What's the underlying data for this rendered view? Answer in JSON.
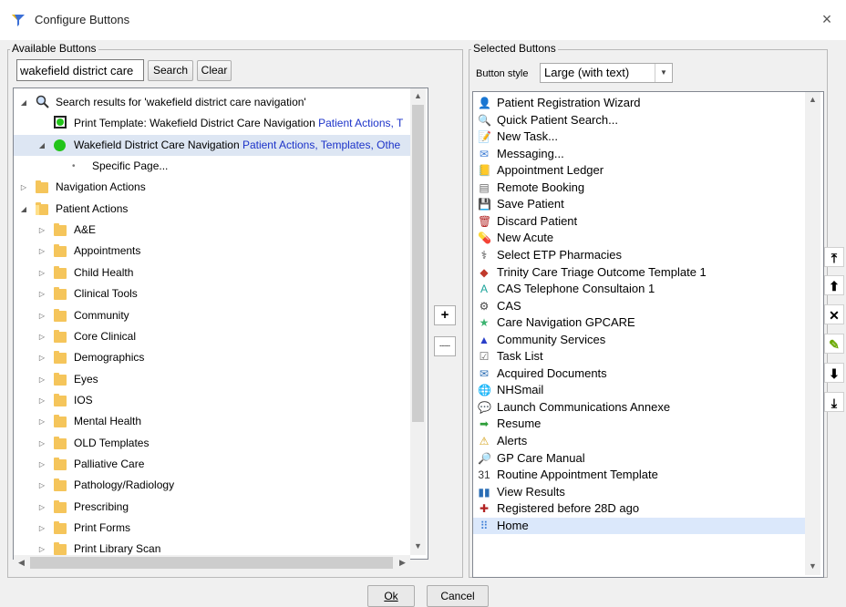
{
  "window": {
    "title": "Configure Buttons",
    "close_glyph": "×",
    "title_icon": "funnel-icon"
  },
  "available": {
    "legend": "Available Buttons",
    "search_value": "wakefield district care",
    "search_button": "Search",
    "clear_button": "Clear",
    "tree": [
      {
        "indent": 0,
        "expander": "◢",
        "icon": "search-icon",
        "text": "Search results for 'wakefield district care navigation'",
        "extra": ""
      },
      {
        "indent": 1,
        "expander": "",
        "icon": "green-dot-boxed-icon",
        "text": "Print Template: Wakefield District Care Navigation ",
        "extra": "Patient Actions, T"
      },
      {
        "indent": 1,
        "expander": "◢",
        "icon": "green-dot-icon",
        "text": "Wakefield District Care Navigation ",
        "extra": "Patient Actions, Templates, Othe",
        "selected": true
      },
      {
        "indent": 2,
        "expander": "",
        "icon": "bullet-icon",
        "text": "Specific Page...",
        "extra": ""
      },
      {
        "indent": 0,
        "expander": "▷",
        "icon": "folder-icon",
        "text": "Navigation Actions",
        "extra": ""
      },
      {
        "indent": 0,
        "expander": "◢",
        "icon": "folder-open-icon",
        "text": "Patient Actions",
        "extra": ""
      },
      {
        "indent": 1,
        "expander": "▷",
        "icon": "folder-icon",
        "text": "A&E",
        "extra": ""
      },
      {
        "indent": 1,
        "expander": "▷",
        "icon": "folder-icon",
        "text": "Appointments",
        "extra": ""
      },
      {
        "indent": 1,
        "expander": "▷",
        "icon": "folder-icon",
        "text": "Child Health",
        "extra": ""
      },
      {
        "indent": 1,
        "expander": "▷",
        "icon": "folder-icon",
        "text": "Clinical Tools",
        "extra": ""
      },
      {
        "indent": 1,
        "expander": "▷",
        "icon": "folder-icon",
        "text": "Community",
        "extra": ""
      },
      {
        "indent": 1,
        "expander": "▷",
        "icon": "folder-icon",
        "text": "Core Clinical",
        "extra": ""
      },
      {
        "indent": 1,
        "expander": "▷",
        "icon": "folder-icon",
        "text": "Demographics",
        "extra": ""
      },
      {
        "indent": 1,
        "expander": "▷",
        "icon": "folder-icon",
        "text": "Eyes",
        "extra": ""
      },
      {
        "indent": 1,
        "expander": "▷",
        "icon": "folder-icon",
        "text": "IOS",
        "extra": ""
      },
      {
        "indent": 1,
        "expander": "▷",
        "icon": "folder-icon",
        "text": "Mental Health",
        "extra": ""
      },
      {
        "indent": 1,
        "expander": "▷",
        "icon": "folder-icon",
        "text": "OLD Templates",
        "extra": ""
      },
      {
        "indent": 1,
        "expander": "▷",
        "icon": "folder-icon",
        "text": "Palliative Care",
        "extra": ""
      },
      {
        "indent": 1,
        "expander": "▷",
        "icon": "folder-icon",
        "text": "Pathology/Radiology",
        "extra": ""
      },
      {
        "indent": 1,
        "expander": "▷",
        "icon": "folder-icon",
        "text": "Prescribing",
        "extra": ""
      },
      {
        "indent": 1,
        "expander": "▷",
        "icon": "folder-icon",
        "text": "Print Forms",
        "extra": ""
      },
      {
        "indent": 1,
        "expander": "▷",
        "icon": "folder-icon",
        "text": "Print Library Scan",
        "extra": ""
      }
    ]
  },
  "middle": {
    "add_glyph": "+",
    "separator_glyph": "......"
  },
  "selected": {
    "legend": "Selected Buttons",
    "style_label": "Button style",
    "style_value": "Large (with text)",
    "items": [
      {
        "icon": "👤",
        "icon_name": "patient-registration-icon",
        "color": "#2a6db5",
        "text": "Patient Registration Wizard"
      },
      {
        "icon": "🔍",
        "icon_name": "quick-search-icon",
        "color": "#555",
        "text": "Quick Patient Search..."
      },
      {
        "icon": "📝",
        "icon_name": "new-task-icon",
        "color": "#8a6d3b",
        "text": "New Task..."
      },
      {
        "icon": "✉",
        "icon_name": "messaging-icon",
        "color": "#3a7bd5",
        "text": "Messaging..."
      },
      {
        "icon": "📒",
        "icon_name": "appointment-ledger-icon",
        "color": "#333",
        "text": "Appointment Ledger"
      },
      {
        "icon": "▤",
        "icon_name": "remote-booking-icon",
        "color": "#666",
        "text": "Remote Booking"
      },
      {
        "icon": "💾",
        "icon_name": "save-icon",
        "color": "#222",
        "text": "Save Patient"
      },
      {
        "icon": "🗑",
        "icon_name": "discard-icon",
        "color": "#b22222",
        "text": "Discard Patient"
      },
      {
        "icon": "💊",
        "icon_name": "new-acute-icon",
        "color": "#333",
        "text": "New Acute"
      },
      {
        "icon": "⚕",
        "icon_name": "etp-pharmacy-icon",
        "color": "#333",
        "text": "Select ETP Pharmacies"
      },
      {
        "icon": "◆",
        "icon_name": "triage-icon",
        "color": "#c0392b",
        "text": "Trinity Care Triage Outcome Template 1"
      },
      {
        "icon": "A",
        "icon_name": "cas-consult-icon",
        "color": "#1aa39a",
        "text": "CAS Telephone Consultaion 1"
      },
      {
        "icon": "⚙",
        "icon_name": "cas-icon",
        "color": "#444",
        "text": "CAS"
      },
      {
        "icon": "★",
        "icon_name": "star-icon",
        "color": "#3cb371",
        "text": "Care Navigation GPCARE"
      },
      {
        "icon": "▲",
        "icon_name": "triangle-icon",
        "color": "#2a3fc9",
        "text": "Community Services"
      },
      {
        "icon": "☑",
        "icon_name": "task-list-icon",
        "color": "#666",
        "text": "Task List"
      },
      {
        "icon": "✉",
        "icon_name": "documents-icon",
        "color": "#2a6db5",
        "text": "Acquired Documents"
      },
      {
        "icon": "🌐",
        "icon_name": "nhsmail-icon",
        "color": "#2a6db5",
        "text": "NHSmail"
      },
      {
        "icon": "💬",
        "icon_name": "communications-icon",
        "color": "#6a5acd",
        "text": "Launch Communications Annexe"
      },
      {
        "icon": "➡",
        "icon_name": "resume-arrow-icon",
        "color": "#2e9e3a",
        "text": "Resume"
      },
      {
        "icon": "⚠",
        "icon_name": "alert-icon",
        "color": "#d4a017",
        "text": "Alerts"
      },
      {
        "icon": "🔎",
        "icon_name": "manual-search-icon",
        "color": "#333",
        "text": "GP Care Manual"
      },
      {
        "icon": "31",
        "icon_name": "calendar-icon",
        "color": "#333",
        "text": "Routine Appointment Template"
      },
      {
        "icon": "▮▮",
        "icon_name": "results-icon",
        "color": "#2a6db5",
        "text": "View Results"
      },
      {
        "icon": "✚",
        "icon_name": "registered-icon",
        "color": "#b22222",
        "text": "Registered before 28D ago"
      },
      {
        "icon": "⠿",
        "icon_name": "home-icon",
        "color": "#3a7bd5",
        "text": "Home",
        "highlight": true
      }
    ]
  },
  "side_buttons": [
    {
      "glyph": "⤒",
      "name": "move-top-button"
    },
    {
      "glyph": "⬆",
      "name": "move-up-button"
    },
    {
      "glyph": "✕",
      "name": "remove-button"
    },
    {
      "glyph": "✎",
      "name": "edit-button"
    },
    {
      "glyph": "⬇",
      "name": "move-down-button"
    },
    {
      "glyph": "⤓",
      "name": "move-bottom-button"
    }
  ],
  "footer": {
    "ok_label": "Ok",
    "cancel_label": "Cancel"
  }
}
